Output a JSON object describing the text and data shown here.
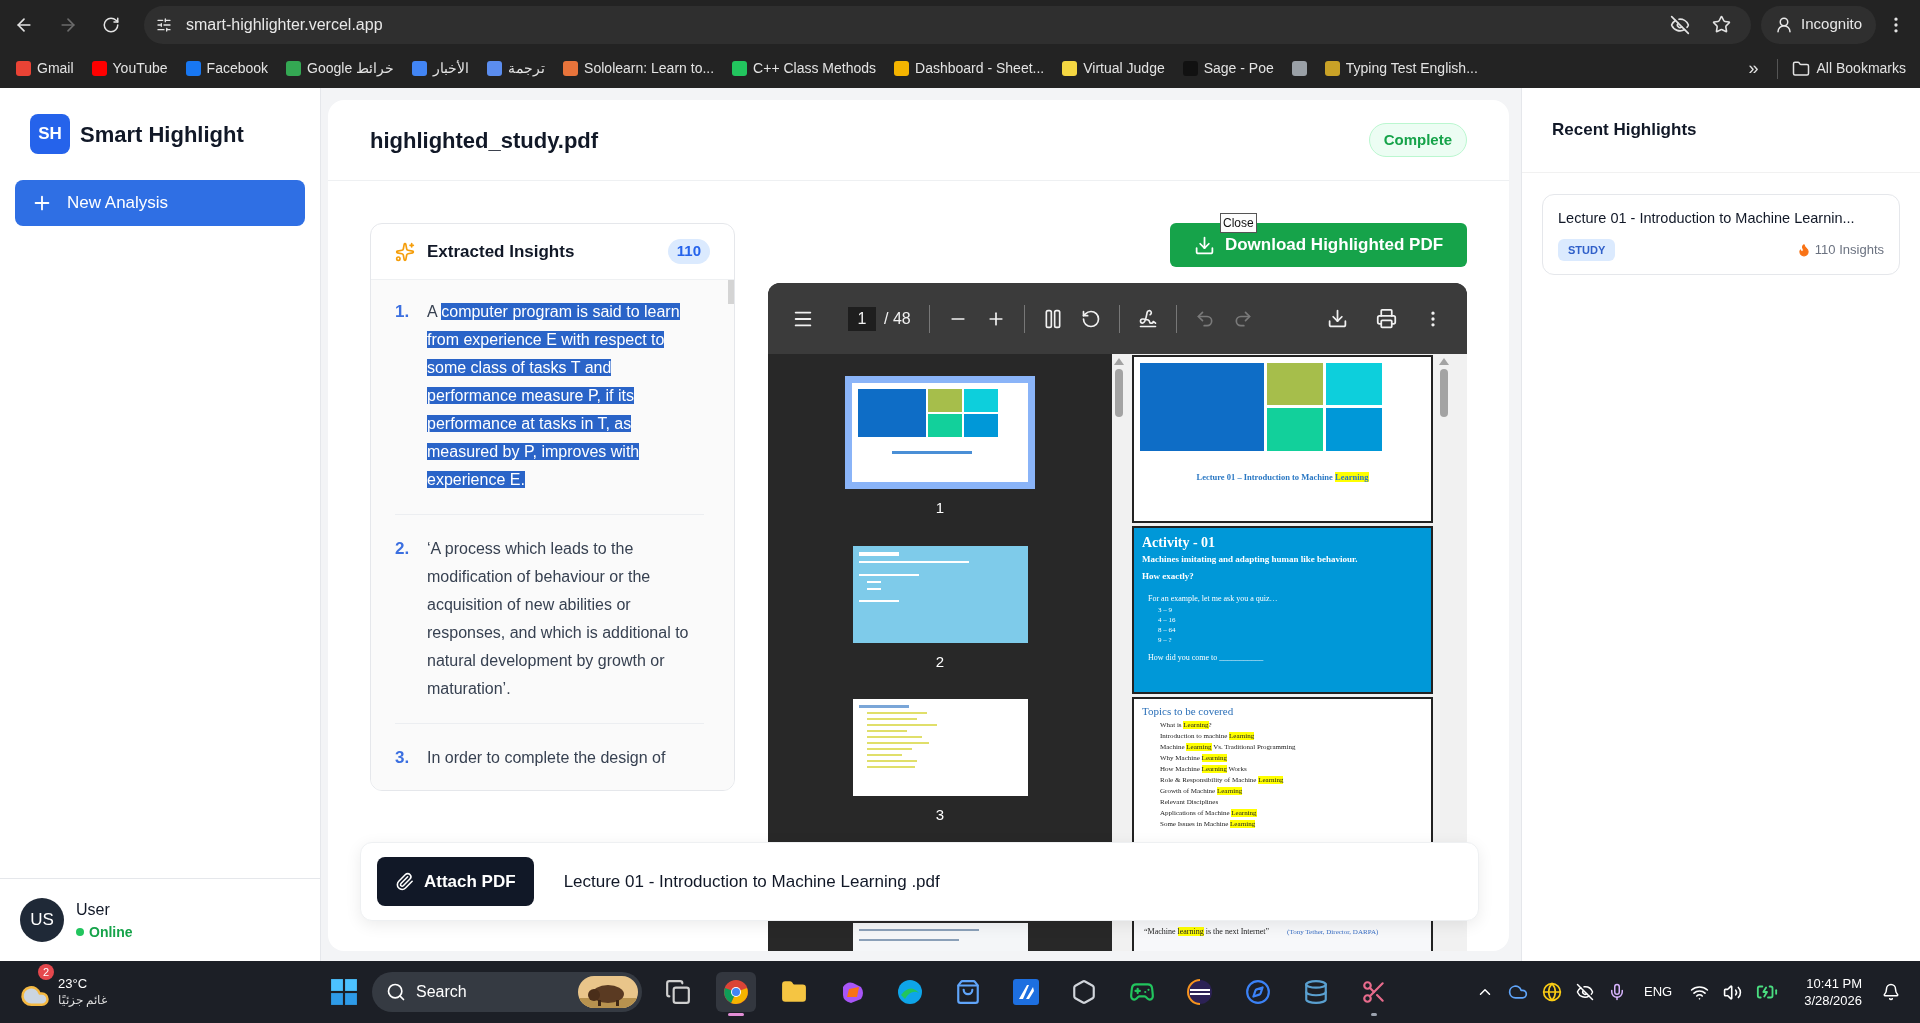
{
  "browser": {
    "back": {
      "disabled": false
    },
    "forward": {
      "disabled": true
    },
    "url": "smart-highlighter.vercel.app",
    "profile": "Incognito",
    "bookmarks": [
      {
        "label": "Gmail",
        "color": "#ea4335"
      },
      {
        "label": "YouTube",
        "color": "#ff0000"
      },
      {
        "label": "Facebook",
        "color": "#1877f2"
      },
      {
        "label": "Google خرائط",
        "color": "#34a853"
      },
      {
        "label": "الأخبار",
        "color": "#4285f4"
      },
      {
        "label": "ترجمة",
        "color": "#5b8def"
      },
      {
        "label": "Sololearn: Learn to...",
        "color": "#e8743b"
      },
      {
        "label": "C++ Class Methods",
        "color": "#22c55e"
      },
      {
        "label": "Dashboard - Sheet...",
        "color": "#f4b400"
      },
      {
        "label": "Virtual Judge",
        "color": "#f5d742"
      },
      {
        "label": "Sage - Poe",
        "color": "#111111"
      },
      {
        "color": "#9aa0a6"
      },
      {
        "label": "Typing Test English...",
        "color": "#c9a227"
      }
    ],
    "more": "»",
    "all_bookmarks": "All Bookmarks"
  },
  "sidebar": {
    "logo": "SH",
    "app_name": "Smart Highlight",
    "new_button": "New Analysis",
    "user": {
      "initials": "US",
      "name": "User",
      "status": "Online",
      "online": true
    }
  },
  "document": {
    "title": "highlighted_study.pdf",
    "status": "Complete",
    "insights": {
      "title": "Extracted Insights",
      "count": "110",
      "items": [
        {
          "number": "1.",
          "parts": [
            {
              "text": "A ",
              "selected": false
            },
            {
              "text": "computer program is said to learn from experience E with respect to some class of tasks T and performance measure P, if its performance at tasks in T, as measured by P, improves with experience E.",
              "selected": true
            }
          ]
        },
        {
          "number": "2.",
          "parts": [
            {
              "text": "‘A process which leads to the modification of behaviour or the acquisition of new abilities or responses, and which is additional to natural development by growth or maturation’.",
              "selected": false
            }
          ]
        },
        {
          "number": "3.",
          "parts": [
            {
              "text": "In order to complete the design of",
              "selected": false
            }
          ]
        }
      ]
    },
    "download": "Download Highlighted PDF",
    "tooltip": "Close",
    "viewer": {
      "page": "1",
      "total": "/ 48",
      "undo": {
        "disabled": true
      },
      "redo": {
        "disabled": true
      },
      "thumbnails": [
        {
          "kind": "title",
          "label": "1",
          "selected": true
        },
        {
          "kind": "activity",
          "label": "2",
          "selected": false
        },
        {
          "kind": "topics",
          "label": "3",
          "selected": false
        },
        {
          "kind": "quote",
          "selected": false
        }
      ],
      "pages": [
        {
          "kind": "title",
          "title": [
            {
              "text": "Lecture 01 – Introduction to Machine ",
              "highlighted": false
            },
            {
              "text": "Learning",
              "highlighted": true
            }
          ]
        },
        {
          "kind": "activity",
          "title": "Activity - 01",
          "subtitle": "Machines imitating and adapting human like behaviour.",
          "question": "How exactly?",
          "lead": "For an example, let me ask you a quiz…",
          "quiz": [
            "3 – 9",
            "4 – 16",
            "8 – 64",
            "9 – ?"
          ],
          "closing": "How did you come to ___________"
        },
        {
          "kind": "topics",
          "title": "Topics to be covered",
          "items": [
            [
              {
                "text": "What is ",
                "highlighted": false
              },
              {
                "text": "Learning",
                "highlighted": true
              },
              {
                "text": "?",
                "highlighted": false
              }
            ],
            [
              {
                "text": "Introduction to machine ",
                "highlighted": false
              },
              {
                "text": "Learning",
                "highlighted": true
              }
            ],
            [
              {
                "text": "Machine ",
                "highlighted": false
              },
              {
                "text": "Learning",
                "highlighted": true
              },
              {
                "text": " Vs. Traditional Programming",
                "highlighted": false
              }
            ],
            [
              {
                "text": "Why Machine ",
                "highlighted": false
              },
              {
                "text": "Learning",
                "highlighted": true
              }
            ],
            [
              {
                "text": "How Machine ",
                "highlighted": false
              },
              {
                "text": "Learning",
                "highlighted": true
              },
              {
                "text": " Works",
                "highlighted": false
              }
            ],
            [
              {
                "text": "Role & Responsibility of Machine ",
                "highlighted": false
              },
              {
                "text": "Learning",
                "highlighted": true
              }
            ],
            [
              {
                "text": "Growth of Machine ",
                "highlighted": false
              },
              {
                "text": "Learning",
                "highlighted": true
              }
            ],
            [
              {
                "text": "Relevant Disciplines",
                "highlighted": false
              }
            ],
            [
              {
                "text": "Applications of Machine ",
                "highlighted": false
              },
              {
                "text": "Learning",
                "highlighted": true
              }
            ],
            [
              {
                "text": "Some Issues in Machine ",
                "highlighted": false
              },
              {
                "text": "Learning",
                "highlighted": true
              }
            ]
          ]
        },
        {
          "kind": "quote",
          "quote": [
            {
              "text": "“Machine ",
              "highlighted": false
            },
            {
              "text": "learning",
              "highlighted": true
            },
            {
              "text": " is the next Internet”",
              "highlighted": false
            }
          ],
          "source": "(Tony Tether, Director, DARPA)"
        }
      ]
    },
    "attach": {
      "button": "Attach PDF",
      "file": "Lecture 01 - Introduction to Machine Learning .pdf"
    }
  },
  "recent": {
    "title": "Recent Highlights",
    "items": [
      {
        "title": "Lecture 01 - Introduction to Machine Learnin...",
        "tag": "STUDY",
        "count": "110 Insights"
      }
    ]
  },
  "taskbar": {
    "weather": {
      "badge": "2",
      "temperature": "23°C",
      "condition": "غائم جزئيًا"
    },
    "search": "Search",
    "apps": [
      {
        "kind": "windows",
        "selected": false,
        "running": false
      },
      {
        "kind": "browser",
        "selected": true,
        "running": true
      },
      {
        "kind": "folder",
        "selected": false,
        "running": false
      },
      {
        "kind": "blob",
        "selected": false,
        "running": false
      },
      {
        "kind": "swirl",
        "selected": false,
        "running": false
      },
      {
        "kind": "bag",
        "selected": false,
        "running": false
      },
      {
        "kind": "tile",
        "selected": false,
        "running": false
      },
      {
        "kind": "hexagon",
        "selected": false,
        "running": false
      },
      {
        "kind": "xbox",
        "selected": false,
        "running": false
      },
      {
        "kind": "eclipse",
        "selected": false,
        "running": false
      },
      {
        "kind": "compass",
        "selected": false,
        "running": false
      },
      {
        "kind": "dolphin",
        "selected": false,
        "running": false
      },
      {
        "kind": "snip",
        "selected": false,
        "running": true
      }
    ],
    "language": "ENG",
    "time": "10:41 PM",
    "date": "3/28/2026"
  }
}
